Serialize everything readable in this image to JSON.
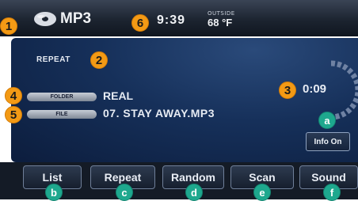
{
  "status_bar": {
    "source": "MP3",
    "clock": "9:39",
    "outside_label": "OUTSIDE",
    "temperature": "68 °F"
  },
  "main": {
    "repeat_label": "REPEAT",
    "folder_tag": "FOLDER",
    "folder_name": "REAL",
    "file_tag": "FILE",
    "file_name": "07. STAY AWAY.MP3",
    "play_time": "0:09",
    "info_button": "Info On"
  },
  "softkeys": [
    "List",
    "Repeat",
    "Random",
    "Scan",
    "Sound"
  ],
  "callouts": {
    "numbers": [
      "1",
      "2",
      "3",
      "4",
      "5",
      "6"
    ],
    "letters": [
      "a",
      "b",
      "c",
      "d",
      "e",
      "f"
    ]
  },
  "colors": {
    "callout_number": "#f39a15",
    "callout_letter": "#1ea88e",
    "panel_blue": "#16305a"
  },
  "icons": [
    "disc-icon",
    "progress-ring-icon"
  ]
}
